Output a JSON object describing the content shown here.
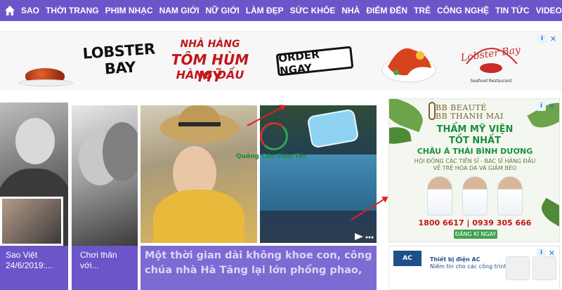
{
  "nav": {
    "items": [
      "SAO",
      "THỜI TRANG",
      "PHIM NHẠC",
      "NAM GIỚI",
      "NỮ GIỚI",
      "LÀM ĐẸP",
      "SỨC KHỎE",
      "NHÀ",
      "ĐIỂM ĐẾN",
      "TRẺ",
      "CÔNG NGHỆ",
      "TIN TỨC",
      "VIDEO"
    ]
  },
  "ad_top": {
    "brand": "LOBSTER BAY",
    "line1": "NHÀ HÀNG",
    "line2": "TÔM HÙM MỸ",
    "line3": "HÀNG ĐẦU",
    "cta": "ORDER NGAY",
    "logo": "Lobster Bay",
    "logo_sub": "Seafood Restaurant"
  },
  "watermark": "Quảng Cáo Siêu Tốc",
  "captions": {
    "c1": "Sao Việt 24/6/2019:...",
    "c2": "Chơi thân với...",
    "c3": "Một thời gian dài không khoe con, công chúa nhà Hà Tăng lại lớn phổng phao,"
  },
  "ad_right": {
    "brand1": "BB BEAUTÉ",
    "brand2": "BB THANH MAI",
    "line1": "THẨM MỸ VIỆN",
    "line2": "TỐT NHẤT",
    "line3": "CHÂU Á THÁI BÌNH DƯƠNG",
    "line4": "HỘI ĐỒNG CÁC TIẾN SĨ - BÁC SĨ HÀNG ĐẦU",
    "line5": "VỀ TRẺ HÓA DA VÀ GIẢM BÉO",
    "phones": "1800 6617  |  0939 305 666",
    "cta": "ĐĂNG KÍ NGAY"
  },
  "ad_right2": {
    "logo": "AC",
    "text1": "Thiết bị điện AC",
    "text2": "Niềm tin cho các công trình"
  },
  "ad_marks": {
    "info": "i",
    "close": "✕"
  }
}
